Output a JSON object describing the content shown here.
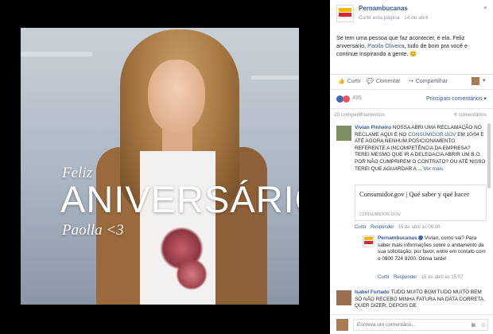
{
  "photo": {
    "feliz": "Feliz",
    "aniversario": "ANIVERSÁRIO",
    "paolla": "Paolla <3"
  },
  "post": {
    "page_name": "Pernambucanas",
    "like_page": "Curtir esta página",
    "date": "14 de abril",
    "text_before": "Se tem uma pessoa que faz acontecer, é ela. Feliz aniversário, ",
    "mention": "Paolla Oliveira",
    "text_after": ", tudo de bom pra você e continue inspirando a gente. 😊"
  },
  "actions": {
    "like": "Curtir",
    "comment": "Comentar",
    "share": "Compartilhar"
  },
  "reactions": {
    "count": "495",
    "order": "Principais comentários ▾"
  },
  "counts": {
    "shares": "20 compartilhamentos",
    "comments": "6 comentários"
  },
  "comments": [
    {
      "author": "Vivian Pinheiro",
      "text": " NOSSA ABRI UMA RECLAMAÇÃO NO RECLAME AQUI E NO ",
      "link": "CONSUMIDOR.GOV",
      "text2": " EM 10/04 E ATÉ AGORA NENHUM POSICIONAMENTO REFERENTE A INCOMPETÊNCIA DA EMPRESA? TEREI MESMO QUE IR A DELEGACIA ABRIR UM B.O. POR NÃO CUMPRIREM O CONTRATO? OU ATÉ NISSO TEREI QUE AGUARDAR A ...",
      "see_more": "Ver mais",
      "card_title": "Consumidor.gov | Qué saber y qué hacer",
      "card_domain": "CONSUMIDOR.GOV",
      "meta_like": "Curtir",
      "meta_reply": "Responder",
      "meta_date": "15 de abril às 08:08"
    },
    {
      "author": "Isabel Furtado",
      "text": " TUDO MUITO BOM TUDO MUITO BEM SÓ NÃO RECEBO MINHA FATURA NA DATA CORRETA, QUER DIZER, DEPOIS DE"
    }
  ],
  "reply": {
    "author": "Pernambucanas",
    "text": " Vivian, como vai? Para saber mais informações sobre o andamento da sua solicitação, por favor, entre em contato com o 0800 724 9200. Ótima tarde!",
    "meta_like": "Curtir",
    "meta_reply": "Responder",
    "meta_date": "15 de abril às 15:07"
  },
  "composer": {
    "placeholder": "Escreva um comentário..."
  },
  "icons": {
    "like": "thumbs-up-icon",
    "comment": "speech-bubble-icon",
    "share": "share-arrow-icon",
    "camera": "camera-icon",
    "emoji": "emoji-icon"
  },
  "colors": {
    "link": "#365899",
    "brand_red": "#d8262e",
    "brand_yellow": "#f6b800"
  }
}
